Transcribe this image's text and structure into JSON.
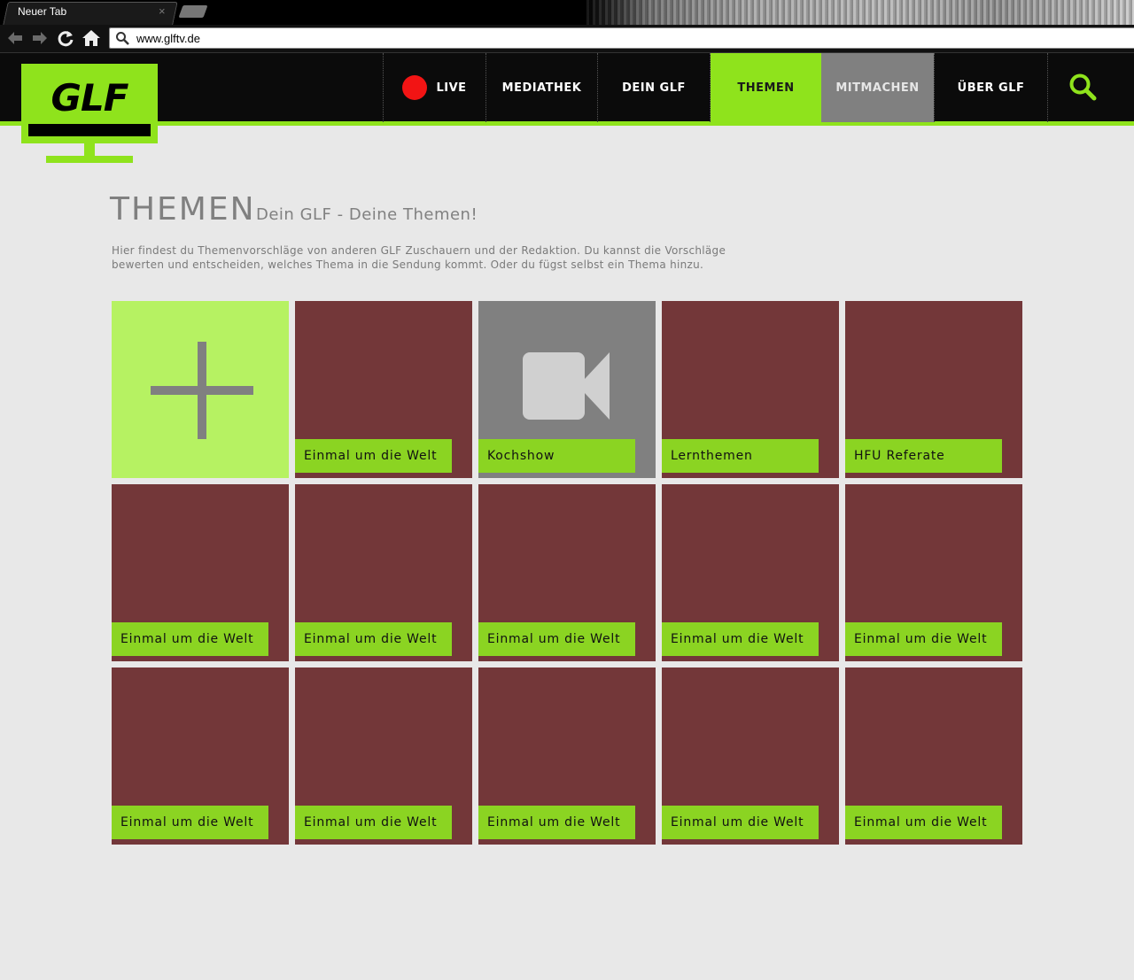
{
  "browser": {
    "tab_title": "Neuer Tab",
    "tab_close": "×",
    "url": "www.glftv.de",
    "nav_icons": [
      "back-arrow-icon",
      "forward-arrow-icon",
      "reload-icon",
      "home-icon"
    ]
  },
  "logo": {
    "text": "GLF"
  },
  "nav": {
    "items": [
      {
        "label": "LIVE"
      },
      {
        "label": "MEDIATHEK"
      },
      {
        "label": "DEIN GLF"
      },
      {
        "label": "THEMEN"
      },
      {
        "label": "MITMACHEN"
      },
      {
        "label": "ÜBER GLF"
      }
    ],
    "active": "THEMEN",
    "hover": "MITMACHEN"
  },
  "page": {
    "title": "THEMEN",
    "subtitle": "Dein GLF - Deine Themen!",
    "intro_line1": "Hier findest du Themenvorschläge von anderen GLF Zuschauern und der Redaktion. Du kannst die Vorschläge",
    "intro_line2": "bewerten und entscheiden, welches Thema in die Sendung kommt. Oder du fügst selbst ein Thema hinzu."
  },
  "tiles": [
    {
      "label": ""
    },
    {
      "label": "Einmal um die Welt"
    },
    {
      "label": "Kochshow"
    },
    {
      "label": "Lernthemen"
    },
    {
      "label": "HFU Referate"
    },
    {
      "label": "Einmal um die Welt"
    },
    {
      "label": "Einmal um die Welt"
    },
    {
      "label": "Einmal um die Welt"
    },
    {
      "label": "Einmal um die Welt"
    },
    {
      "label": "Einmal um die Welt"
    },
    {
      "label": "Einmal um die Welt"
    },
    {
      "label": "Einmal um die Welt"
    },
    {
      "label": "Einmal um die Welt"
    },
    {
      "label": "Einmal um die Welt"
    },
    {
      "label": "Einmal um die Welt"
    }
  ],
  "colors": {
    "accent_green": "#8fe31c",
    "tile_label_green": "#8bd422",
    "tile_add": "#b6f262",
    "tile_maroon": "#733739",
    "tile_gray": "#808080",
    "live_red": "#f21414"
  }
}
